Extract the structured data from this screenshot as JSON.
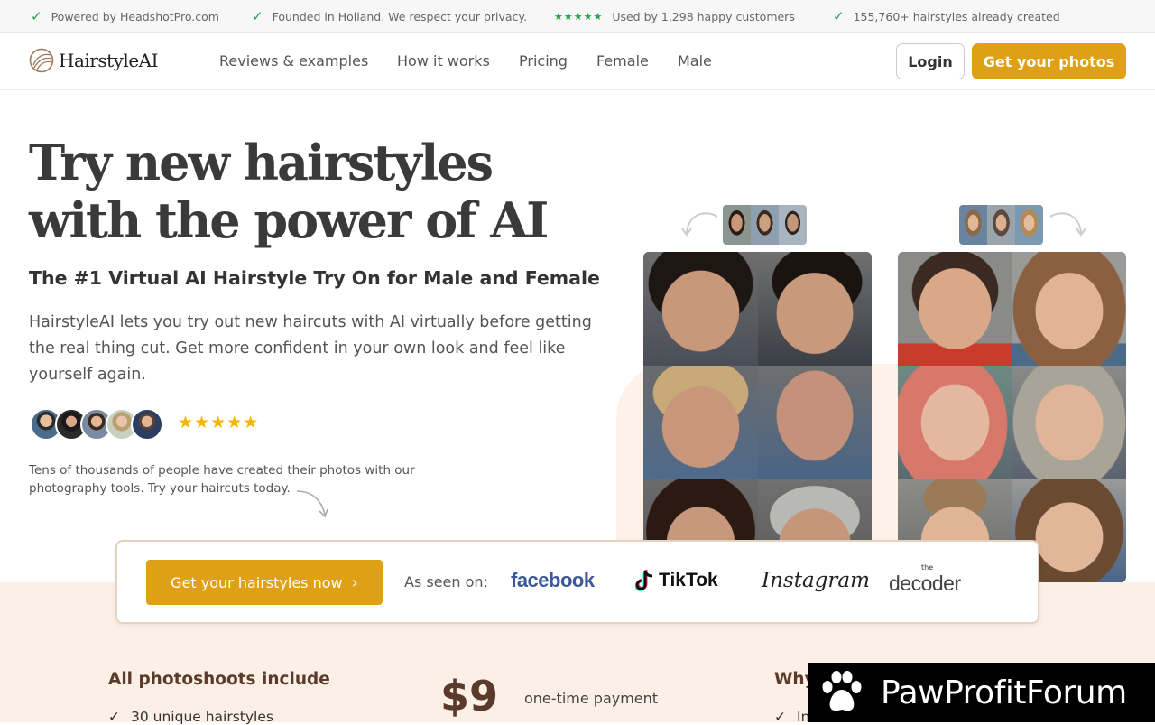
{
  "topbar": {
    "item1": "Powered by HeadshotPro.com",
    "item2": "Founded in Holland. We respect your privacy.",
    "item3_stars": "★★★★★",
    "item3": "Used by 1,298 happy customers",
    "item4": "155,760+ hairstyles already created"
  },
  "nav": {
    "logo": "HairstyleAI",
    "links": [
      "Reviews & examples",
      "How it works",
      "Pricing",
      "Female",
      "Male"
    ],
    "login": "Login",
    "cta": "Get your photos"
  },
  "hero": {
    "title_line1": "Try new hairstyles",
    "title_line2": "with the power of AI",
    "subtitle": "The #1 Virtual AI Hairstyle Try On for Male and Female",
    "description": "HairstyleAI lets you try out new haircuts with AI virtually before getting the real thing cut. Get more confident in your own look and feel like yourself again.",
    "stars": "★★★★★",
    "social_note": "Tens of thousands of people have created their photos with our photography tools. Try your haircuts today."
  },
  "cta_bar": {
    "button": "Get your hairstyles now",
    "chevron": "›",
    "seen_on": "As seen on:",
    "brands": [
      "facebook",
      "TikTok",
      "Instagram",
      "decoder"
    ],
    "decoder_prefix": "the"
  },
  "pricing": {
    "includes_title": "All photoshoots include",
    "includes_item1": "30 unique hairstyles",
    "price": "$9",
    "price_note": "one-time payment",
    "why_title": "Why",
    "why_item1": "In"
  },
  "watermark": {
    "text": "PawProfitForum"
  },
  "colors": {
    "accent": "#e0a015",
    "check": "#22a34a",
    "peach": "#fcefe5",
    "brown": "#5a3a2a",
    "facebook": "#3b5998"
  }
}
